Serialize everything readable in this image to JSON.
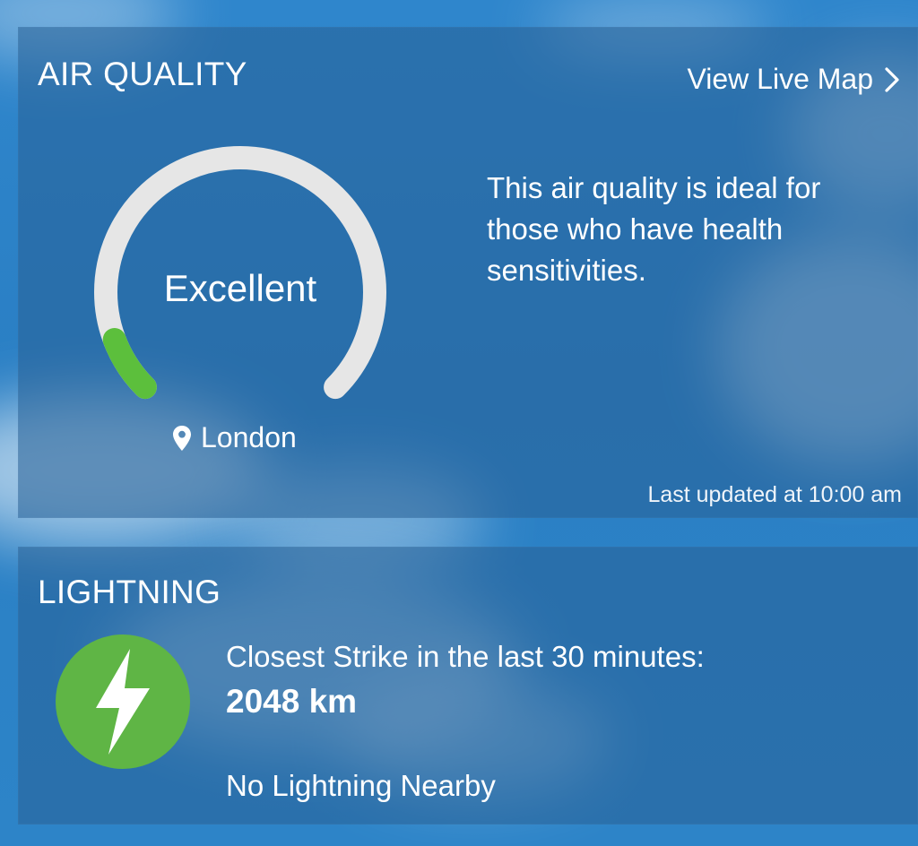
{
  "colors": {
    "gauge_track": "#e6e6e6",
    "gauge_fill": "#5cbf3c",
    "lightning_badge": "#5fb545"
  },
  "air_quality": {
    "title": "AIR QUALITY",
    "live_map_label": "View Live Map",
    "level": "Excellent",
    "level_fraction": 0.09,
    "location": "London",
    "description": "This air quality is ideal for those who have health sensitivities.",
    "updated": "Last updated at 10:00 am",
    "icons": {
      "location": "map-pin-icon",
      "link": "chevron-right-icon"
    }
  },
  "lightning": {
    "title": "LIGHTNING",
    "caption": "Closest Strike in the last 30 minutes:",
    "distance": "2048 km",
    "status": "No Lightning Nearby",
    "icon": "lightning-bolt-icon"
  }
}
